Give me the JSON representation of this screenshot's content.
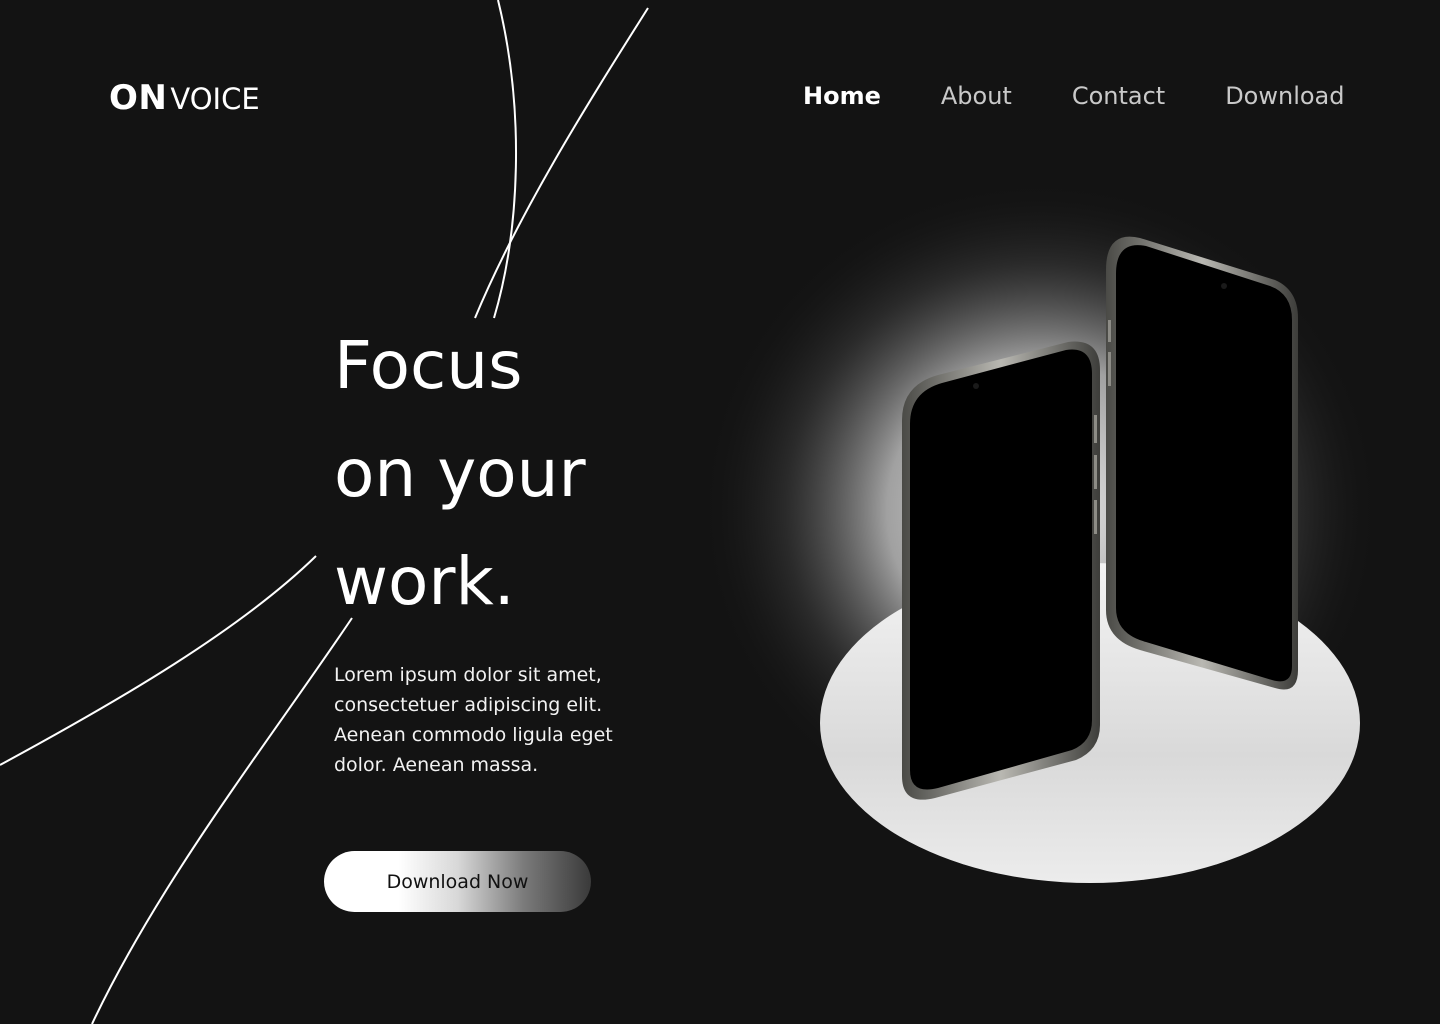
{
  "brand": {
    "strong": "ON",
    "light": "VOICE"
  },
  "nav": {
    "items": [
      {
        "label": "Home",
        "active": true
      },
      {
        "label": "About",
        "active": false
      },
      {
        "label": "Contact",
        "active": false
      },
      {
        "label": "Download",
        "active": false
      }
    ]
  },
  "hero": {
    "title_lines": [
      "Focus",
      "on your",
      "work."
    ],
    "description": "Lorem ipsum dolor sit amet, consectetuer adipiscing elit. Aenean commodo ligula eget dolor. Aenean massa.",
    "cta_label": "Download Now"
  },
  "colors": {
    "background": "#131313",
    "text": "#ffffff",
    "nav_inactive": "#c9c9c9"
  }
}
